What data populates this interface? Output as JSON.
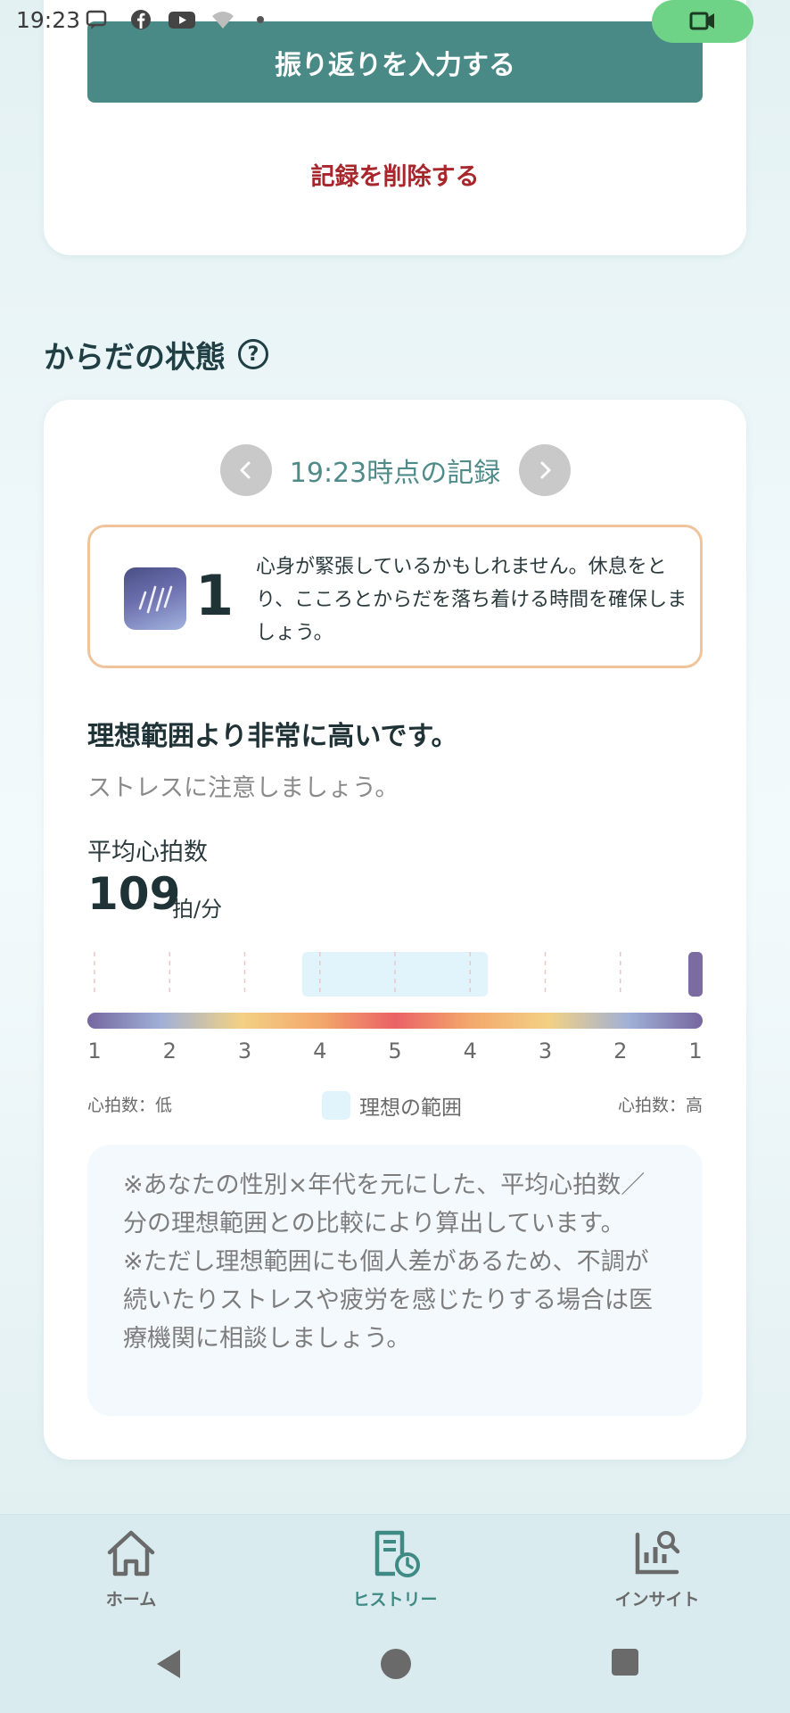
{
  "status_bar": {
    "time": "19:23"
  },
  "top_card": {
    "primary_button": "振り返りを入力する",
    "delete_link": "記録を削除する"
  },
  "section": {
    "title": "からだの状態",
    "help_icon": "question-circle-icon"
  },
  "record": {
    "time_label": "19:23時点の記録",
    "prev_icon": "chevron-left-icon",
    "next_icon": "chevron-right-icon"
  },
  "alert": {
    "level": "1",
    "icon": "stress-level-icon",
    "message": "心身が緊張しているかもしれません。休息をとり、こころとからだを落ち着ける時間を確保しましょう。"
  },
  "assessment": {
    "headline": "理想範囲より非常に高いです。",
    "subline": "ストレスに注意しましょう。"
  },
  "heart_rate": {
    "label": "平均心拍数",
    "value": "109",
    "unit": "拍/分"
  },
  "scale": {
    "ticks": [
      "1",
      "2",
      "3",
      "4",
      "5",
      "4",
      "3",
      "2",
      "1"
    ],
    "ideal_range_ticks": [
      4,
      5,
      4
    ],
    "current_marker_tick": 9,
    "low_label": "心拍数：低",
    "high_label": "心拍数：高",
    "ideal_label": "理想の範囲",
    "colors": {
      "ideal": "#e2f4fb",
      "marker": "#7a6ba0"
    }
  },
  "note": {
    "line1": "※あなたの性別×年代を元にした、平均心拍数／分の理想範囲との比較により算出しています。",
    "line2": "※ただし理想範囲にも個人差があるため、不調が続いたりストレスや疲労を感じたりする場合は医療機関に相談しましょう。"
  },
  "bottom_nav": {
    "tabs": [
      {
        "label": "ホーム",
        "icon": "home-icon",
        "active": false
      },
      {
        "label": "ヒストリー",
        "icon": "history-icon",
        "active": true
      },
      {
        "label": "インサイト",
        "icon": "insight-icon",
        "active": false
      }
    ],
    "colors": {
      "active": "#3f8a84",
      "inactive": "#6a6a6a"
    }
  },
  "colors": {
    "accent": "#4a8a86",
    "danger": "#a8272d",
    "alert_border": "#f0c49a"
  }
}
